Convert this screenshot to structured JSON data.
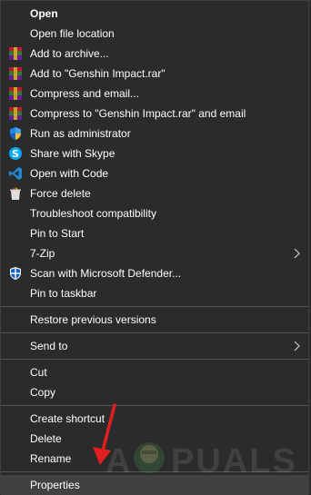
{
  "menu": {
    "items": [
      {
        "label": "Open"
      },
      {
        "label": "Open file location"
      },
      {
        "label": "Add to archive..."
      },
      {
        "label": "Add to \"Genshin Impact.rar\""
      },
      {
        "label": "Compress and email..."
      },
      {
        "label": "Compress to \"Genshin Impact.rar\" and email"
      },
      {
        "label": "Run as administrator"
      },
      {
        "label": "Share with Skype"
      },
      {
        "label": "Open with Code"
      },
      {
        "label": "Force delete"
      },
      {
        "label": "Troubleshoot compatibility"
      },
      {
        "label": "Pin to Start"
      },
      {
        "label": "7-Zip"
      },
      {
        "label": "Scan with Microsoft Defender..."
      },
      {
        "label": "Pin to taskbar"
      },
      {
        "label": "Restore previous versions"
      },
      {
        "label": "Send to"
      },
      {
        "label": "Cut"
      },
      {
        "label": "Copy"
      },
      {
        "label": "Create shortcut"
      },
      {
        "label": "Delete"
      },
      {
        "label": "Rename"
      },
      {
        "label": "Properties"
      }
    ]
  },
  "watermark": {
    "text": "APPUALS"
  },
  "colors": {
    "background": "#2b2b2b",
    "text": "#ffffff",
    "separator": "#555555",
    "hover": "#414141",
    "annotation_arrow": "#e02020"
  }
}
